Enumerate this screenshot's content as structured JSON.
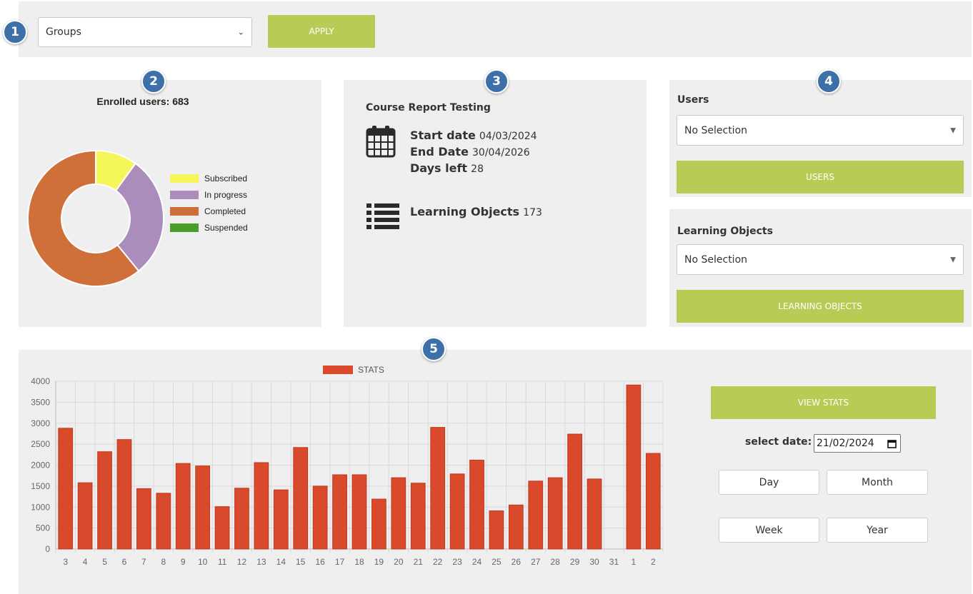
{
  "filter": {
    "groups_value": "Groups",
    "apply_label": "APPLY"
  },
  "badges": [
    "1",
    "2",
    "3",
    "4",
    "5"
  ],
  "enrollment": {
    "title": "Enrolled users: 683",
    "legend": [
      {
        "label": "Subscribed",
        "color": "#f4f757",
        "value": 68
      },
      {
        "label": "In progress",
        "color": "#ab8dbb",
        "value": 199
      },
      {
        "label": "Completed",
        "color": "#cf703a",
        "value": 416
      },
      {
        "label": "Suspended",
        "color": "#4a9e2a",
        "value": 0
      }
    ]
  },
  "course": {
    "title": "Course Report Testing",
    "start_label": "Start date",
    "start_value": "04/03/2024",
    "end_label": "End Date",
    "end_value": "30/04/2026",
    "days_label": "Days left",
    "days_value": "28",
    "lo_label": "Learning Objects",
    "lo_value": "173"
  },
  "users_panel": {
    "heading": "Users",
    "select_value": "No Selection",
    "button_label": "USERS"
  },
  "lo_panel": {
    "heading": "Learning Objects",
    "select_value": "No Selection",
    "button_label": "LEARNING OBJECTS"
  },
  "stats_controls": {
    "view_stats_label": "VIEW STATS",
    "select_date_label": "select date:",
    "date_value": "21/02/2024",
    "day_label": "Day",
    "month_label": "Month",
    "week_label": "Week",
    "year_label": "Year"
  },
  "chart_data": {
    "type": "bar",
    "legend": "STATS",
    "color": "#d9492b",
    "categories": [
      "3",
      "4",
      "5",
      "6",
      "7",
      "8",
      "9",
      "10",
      "11",
      "12",
      "13",
      "14",
      "15",
      "16",
      "17",
      "18",
      "19",
      "20",
      "21",
      "22",
      "23",
      "24",
      "25",
      "26",
      "27",
      "28",
      "29",
      "30",
      "31",
      "1",
      "2"
    ],
    "values": [
      2880,
      1580,
      2320,
      2610,
      1440,
      1330,
      2040,
      1980,
      1010,
      1450,
      2060,
      1410,
      2420,
      1500,
      1770,
      1770,
      1190,
      1700,
      1570,
      2900,
      1790,
      2120,
      910,
      1050,
      1620,
      1700,
      2740,
      1670,
      0,
      3910,
      2280
    ],
    "ylim": [
      0,
      4000
    ],
    "yticks": [
      0,
      500,
      1000,
      1500,
      2000,
      2500,
      3000,
      3500,
      4000
    ],
    "grid": true,
    "legend_placement": "top-center"
  }
}
